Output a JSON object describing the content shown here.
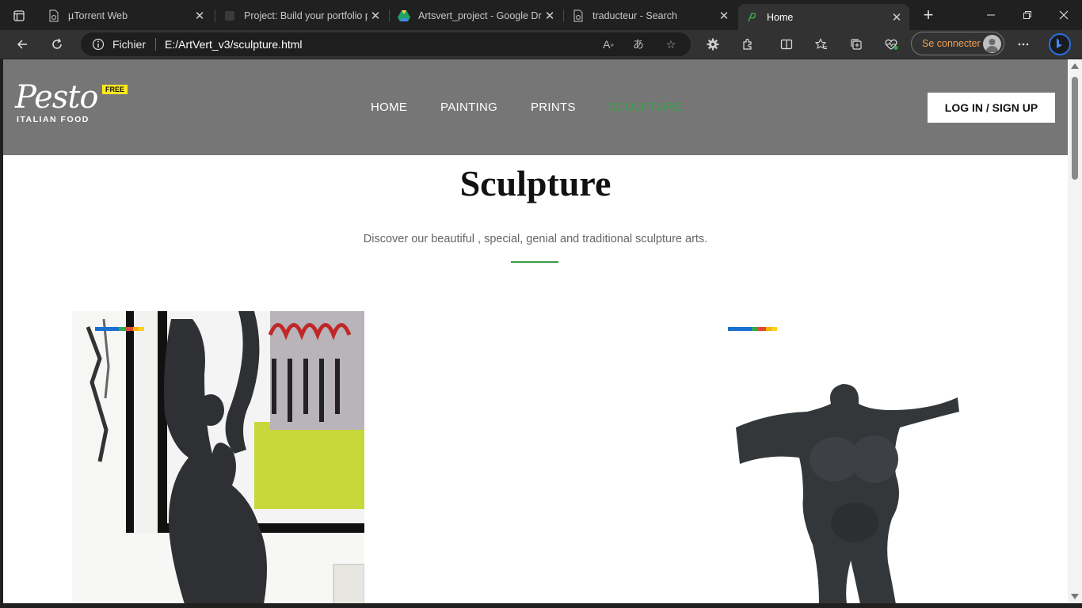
{
  "tabs": [
    {
      "label": "µTorrent Web",
      "icon": "utorrent-icon"
    },
    {
      "label": "Project: Build your portfolio p",
      "icon": "project-icon"
    },
    {
      "label": "Artsvert_project - Google Dri",
      "icon": "google-drive-icon"
    },
    {
      "label": "traducteur - Search",
      "icon": "search-page-icon"
    },
    {
      "label": "Home",
      "icon": "pesto-favicon-icon",
      "active": true
    }
  ],
  "address_bar": {
    "scheme_label": "Fichier",
    "url": "E:/ArtVert_v3/sculpture.html"
  },
  "profile": {
    "signin_label": "Se connecter"
  },
  "site": {
    "logo_text": "Pesto",
    "logo_sub": "ITALIAN FOOD",
    "badge": "FREE",
    "nav": [
      {
        "label": "HOME"
      },
      {
        "label": "PAINTING"
      },
      {
        "label": "PRINTS"
      },
      {
        "label": "SCULPTURE",
        "active": true
      }
    ],
    "login_label": "LOG IN / SIGN UP"
  },
  "content": {
    "title": "Sculpture",
    "subtitle": "Discover our beautiful , special, genial and traditional sculpture arts."
  },
  "colors": {
    "header_bg": "#767677",
    "accent_green": "#3aa34a",
    "badge_yellow": "#ffe81c",
    "stripe": [
      "#1a6fd0",
      "#1a6fd0",
      "#33a852",
      "#e8472f",
      "#f4b400",
      "#ffd21f"
    ]
  }
}
